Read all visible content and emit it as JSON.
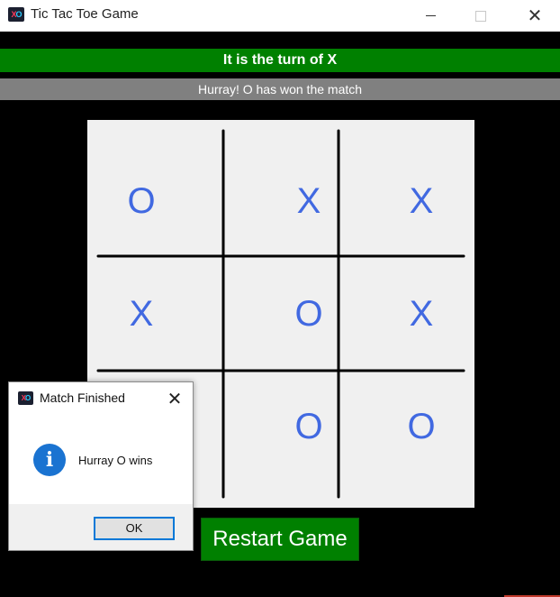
{
  "window": {
    "title": "Tic Tac Toe Game"
  },
  "app_icon": {
    "x_glyph": "X",
    "o_glyph": "O"
  },
  "header": {
    "turn_text": "It is the turn of X",
    "status_text": "Hurray! O has won the match"
  },
  "board": {
    "cells": [
      "O",
      "X",
      "X",
      "X",
      "O",
      "X",
      "",
      "O",
      "O"
    ]
  },
  "restart_label": "Restart Game",
  "dialog": {
    "title": "Match Finished",
    "message": "Hurray O wins",
    "ok_label": "OK",
    "close_glyph": "✕",
    "info_glyph": "i"
  },
  "colors": {
    "turn_bar": "#008000",
    "status_bar": "#808080",
    "mark_color": "#4169e1",
    "background": "#000000",
    "board_background": "#f0f0f0"
  }
}
